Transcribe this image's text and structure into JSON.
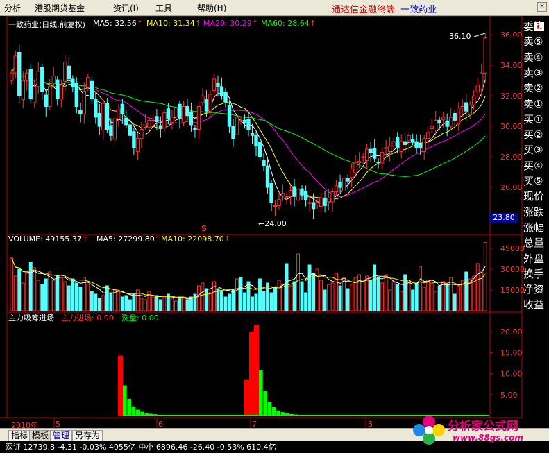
{
  "menu": {
    "items": [
      "分析",
      "港股期货基金",
      "资讯(I)",
      "工具",
      "帮助(H)"
    ],
    "app_name": "通达信金融终端",
    "stock_name": "一致药业"
  },
  "price_header": {
    "title": "一致药业(日线,前复权)",
    "ma5": "MA5: 32.56",
    "ma10": "MA10: 31.34",
    "ma20": "MA20: 30.29",
    "ma60": "MA60: 28.64"
  },
  "volume_header": {
    "volume": "VOLUME: 49155.37",
    "ma5": "MA5: 27299.80",
    "ma10": "MA10: 22098.70"
  },
  "indicator_header": {
    "name": "主力吸筹进场",
    "inflow": "主力进场: 0.00",
    "wash": "洗盘: 0.00"
  },
  "annotations": {
    "high": "36.10",
    "low": "24.00",
    "current_price": "23.80",
    "signal_mark": "S"
  },
  "x_axis": {
    "year": "2010年",
    "months": [
      "5",
      "6",
      "7",
      "8"
    ]
  },
  "right_panel": {
    "items": [
      "委比",
      "卖⑤",
      "卖④",
      "卖③",
      "卖②",
      "卖①",
      "买①",
      "买②",
      "买③",
      "买④",
      "买⑤",
      "现价",
      "涨跌",
      "涨幅",
      "总量",
      "外盘",
      "换手",
      "净资",
      "收益"
    ]
  },
  "bottom_tabs": [
    "指标",
    "模板",
    "管理",
    "另存为"
  ],
  "ticker": {
    "text": "深证 12739.8  -4.31  -0.03%  4055亿   中小 6896.46  -26.40  -0.53%   610.4亿"
  },
  "watermark": {
    "brand": "分析家公式网",
    "url": "www.88gs.com"
  },
  "colors": {
    "up": "#ff3232",
    "down": "#54ffff",
    "ma5": "#ffffff",
    "ma10": "#ffff00",
    "ma20": "#ff00ff",
    "ma60": "#00ff00",
    "axis": "#c00000"
  },
  "chart_data": [
    {
      "type": "candlestick",
      "title": "一致药业(日线,前复权)",
      "ylim": [
        23,
        36.6
      ],
      "y_ticks": [
        26,
        28,
        30,
        32,
        34,
        36
      ],
      "high": 36.1,
      "low": 24.0,
      "current": 23.8,
      "closes": [
        33.5,
        34.6,
        32.0,
        33.0,
        33.5,
        31.8,
        32.6,
        33.6,
        32.3,
        31.3,
        32.6,
        33.3,
        31.8,
        32.7,
        34.2,
        33.1,
        32.6,
        31.3,
        30.8,
        32.3,
        33.2,
        31.8,
        30.6,
        30.0,
        31.5,
        29.8,
        29.4,
        30.5,
        31.2,
        30.8,
        30.1,
        29.4,
        28.6,
        29.2,
        29.8,
        30.2,
        30.4,
        30.4,
        30.3,
        29.9,
        30.9,
        30.5,
        30.6,
        31.2,
        30.5,
        31.3,
        30.7,
        30.1,
        29.8,
        31.3,
        32.0,
        31.0,
        32.1,
        33.1,
        32.6,
        32.0,
        31.6,
        30.0,
        29.2,
        30.6,
        30.4,
        30.2,
        29.8,
        29.4,
        28.7,
        28.0,
        27.4,
        26.0,
        25.0,
        24.8,
        25.2,
        25.6,
        25.4,
        25.8,
        25.4,
        25.9,
        25.5,
        25.2,
        25.0,
        24.6,
        25.0,
        25.3,
        24.8,
        25.3,
        25.7,
        26.1,
        26.0,
        26.6,
        26.4,
        27.2,
        27.6,
        27.7,
        28.0,
        28.5,
        28.3,
        27.9,
        27.6,
        28.3,
        28.6,
        28.7,
        29.0,
        28.6,
        29.0,
        28.8,
        29.4,
        29.0,
        28.6,
        28.6,
        29.2,
        29.6,
        30.0,
        30.4,
        30.2,
        30.6,
        30.0,
        30.6,
        30.4,
        31.2,
        31.3,
        31.0,
        31.4,
        32.0,
        32.7,
        33.5,
        35.8
      ]
    },
    {
      "type": "bar",
      "title": "VOLUME",
      "ylim": [
        0,
        50000
      ],
      "y_ticks": [
        15000,
        30000,
        45000
      ],
      "values": [
        38000,
        25000,
        30000,
        20000,
        27000,
        35000,
        31000,
        22000,
        19000,
        23000,
        28000,
        22000,
        25000,
        24000,
        21000,
        18000,
        23000,
        20000,
        17000,
        24000,
        19000,
        14000,
        12000,
        9000,
        11000,
        18000,
        13000,
        15000,
        14000,
        10000,
        11000,
        8000,
        12000,
        15000,
        9000,
        8000,
        14000,
        10000,
        11000,
        8000,
        10000,
        12000,
        9000,
        7000,
        10000,
        9000,
        8000,
        10000,
        12000,
        18000,
        20000,
        16000,
        13000,
        21000,
        16000,
        14000,
        10000,
        12000,
        15000,
        23000,
        24000,
        13000,
        21000,
        10000,
        12000,
        23000,
        14000,
        20000,
        13000,
        17000,
        22000,
        19000,
        34000,
        18000,
        21000,
        41000,
        21000,
        13000,
        33000,
        27000,
        30000,
        22000,
        15000,
        19000,
        20000,
        27000,
        18000,
        24000,
        16000,
        19000,
        24000,
        26000,
        21000,
        25000,
        22000,
        33000,
        24000,
        20000,
        26000,
        15000,
        21000,
        19000,
        14000,
        26000,
        22000,
        15000,
        20000,
        32000,
        17000,
        22000,
        20000,
        14000,
        18000,
        21000,
        19000,
        24000,
        12000,
        18000,
        22000,
        28000,
        23000,
        25000,
        34000,
        28000,
        49155
      ]
    },
    {
      "type": "bar",
      "title": "主力吸筹进场",
      "ylim": [
        0,
        23
      ],
      "y_ticks": [
        5,
        10,
        15,
        20
      ],
      "series": [
        {
          "name": "主力进场",
          "values": [
            14.3,
            20.0,
            21.6,
            8.5
          ]
        },
        {
          "name": "洗盘",
          "values": [
            7.2,
            4.0,
            2.2,
            1.4,
            0.9,
            0.6,
            0.4,
            0.3,
            0.2,
            0.15,
            0.1,
            0.08,
            10.8,
            5.8,
            3.2,
            2.0,
            1.2,
            0.8,
            0.5,
            0.35,
            0.25,
            0.15,
            0.1
          ]
        }
      ]
    }
  ]
}
